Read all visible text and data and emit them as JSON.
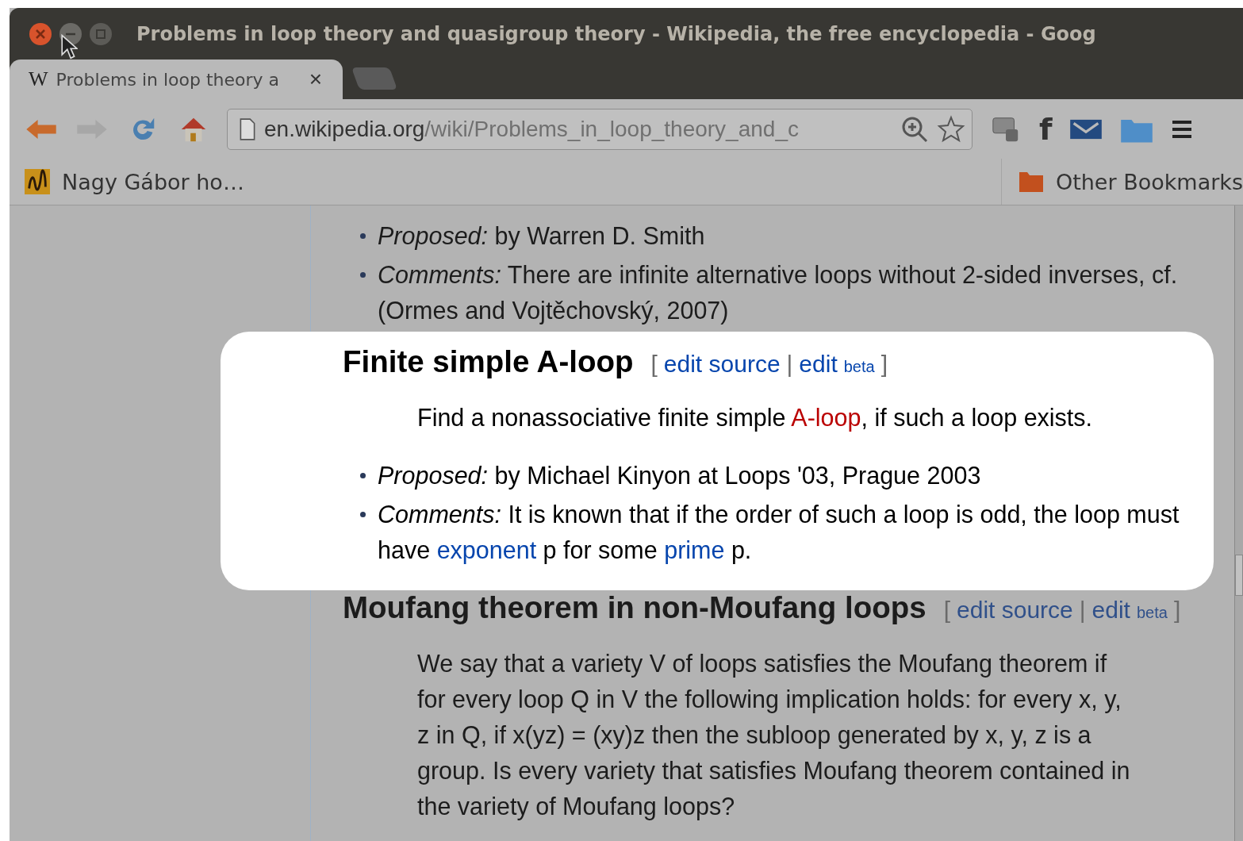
{
  "window": {
    "title": "Problems in loop theory and quasigroup theory - Wikipedia, the free encyclopedia - Goog"
  },
  "tabs": [
    {
      "favicon": "W",
      "label": "Problems in loop theory a",
      "close": "×",
      "selected": true
    }
  ],
  "address_bar": {
    "host": "en.wikipedia.org",
    "path": "/wiki/Problems_in_loop_theory_and_c"
  },
  "toolbar": {
    "back_enabled": true,
    "forward_enabled": false,
    "facebook": "f"
  },
  "bookmarks": [
    {
      "label": "Nagy Gábor ho…",
      "kind": "site"
    },
    {
      "label": "Other Bookmarks",
      "kind": "folder"
    }
  ],
  "article": {
    "sections": [
      {
        "highlighted": false,
        "blocks": [
          {
            "kind": "bullet",
            "segments": [
              {
                "kind": "italic",
                "text": "Proposed:"
              },
              {
                "kind": "plain",
                "text": " by Warren D. Smith"
              }
            ]
          },
          {
            "kind": "bullet",
            "segments": [
              {
                "kind": "italic",
                "text": "Comments:"
              },
              {
                "kind": "plain",
                "text": " There are infinite alternative loops without 2-sided inverses, cf. (Ormes and Vojtěchovský, 2007)"
              }
            ]
          }
        ]
      },
      {
        "highlighted": true,
        "heading": "Finite simple A-loop",
        "edit": {
          "open": "[",
          "source": "edit source",
          "sep": "|",
          "edit": "edit",
          "beta": "beta",
          "close": "]"
        },
        "blocks": [
          {
            "kind": "problem",
            "segments": [
              {
                "kind": "plain",
                "text": "Find a nonassociative finite simple "
              },
              {
                "kind": "redlink",
                "text": "A-loop"
              },
              {
                "kind": "plain",
                "text": ", if such a loop exists."
              }
            ]
          },
          {
            "kind": "bullet",
            "segments": [
              {
                "kind": "italic",
                "text": "Proposed:"
              },
              {
                "kind": "plain",
                "text": " by Michael Kinyon at Loops '03, Prague 2003"
              }
            ]
          },
          {
            "kind": "bullet",
            "segments": [
              {
                "kind": "italic",
                "text": "Comments:"
              },
              {
                "kind": "plain",
                "text": " It is known that if the order of such a loop is odd, the loop must have "
              },
              {
                "kind": "link",
                "text": "exponent"
              },
              {
                "kind": "plain",
                "text": " p for some "
              },
              {
                "kind": "link",
                "text": "prime"
              },
              {
                "kind": "plain",
                "text": " p."
              }
            ]
          }
        ]
      },
      {
        "highlighted": false,
        "heading": "Moufang theorem in non-Moufang loops",
        "edit": {
          "open": "[",
          "source": "edit source",
          "sep": "|",
          "edit": "edit",
          "beta": "beta",
          "close": "]"
        },
        "blocks": [
          {
            "kind": "problem",
            "segments": [
              {
                "kind": "plain",
                "text": "We say that a variety V of loops satisfies the Moufang theorem if for every loop Q in V the following implication holds: for every x, y, z in Q, if x(yz) = (xy)z then the subloop generated by x, y, z is a group. Is every variety that satisfies Moufang theorem contained in the variety of Moufang loops?"
              }
            ]
          }
        ]
      }
    ]
  }
}
